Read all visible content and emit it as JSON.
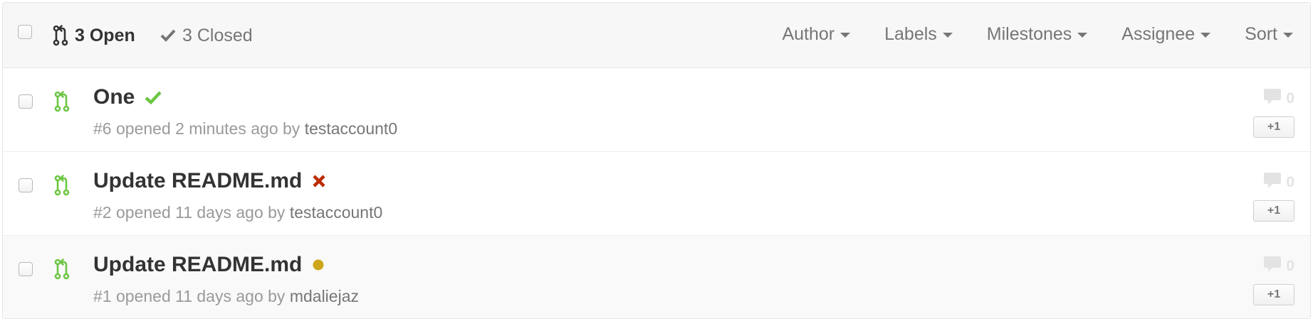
{
  "header": {
    "open_count_label": "3 Open",
    "closed_count_label": "3 Closed",
    "filters": {
      "author": "Author",
      "labels": "Labels",
      "milestones": "Milestones",
      "assignee": "Assignee",
      "sort": "Sort"
    }
  },
  "pull_requests": [
    {
      "title": "One",
      "number": "#6",
      "opened_word": "opened",
      "age": "2 minutes ago",
      "by_word": "by",
      "author": "testaccount0",
      "status": "success",
      "comments": "0",
      "plus_one_label": "+1"
    },
    {
      "title": "Update README.md",
      "number": "#2",
      "opened_word": "opened",
      "age": "11 days ago",
      "by_word": "by",
      "author": "testaccount0",
      "status": "failure",
      "comments": "0",
      "plus_one_label": "+1"
    },
    {
      "title": "Update README.md",
      "number": "#1",
      "opened_word": "opened",
      "age": "11 days ago",
      "by_word": "by",
      "author": "mdaliejaz",
      "status": "pending",
      "comments": "0",
      "plus_one_label": "+1"
    }
  ],
  "colors": {
    "open_icon": "#6cc644",
    "status_success": "#6cc644",
    "status_failure": "#bd2c00",
    "status_pending": "#cea61b",
    "muted_text": "#767676"
  },
  "icons": {
    "state_open": "git-pull-request-icon",
    "state_closed": "check-icon",
    "comment": "comment-icon",
    "row_state": "git-pull-request-icon"
  }
}
